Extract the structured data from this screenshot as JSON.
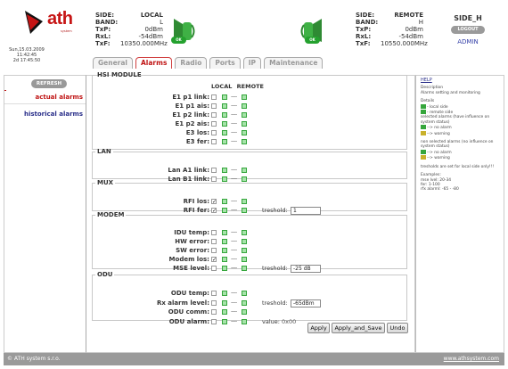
{
  "header": {
    "logo": {
      "text": "ath",
      "subtext": "system"
    },
    "clock": {
      "date": "Sun,15.03.2009",
      "time": "11:42:45",
      "uptime": "2d 17:45:50"
    },
    "local": {
      "side_label": "SIDE:",
      "side_value": "LOCAL",
      "band_label": "BAND:",
      "band_value": "L",
      "txp_label": "TxP:",
      "txp_value": "0dBm",
      "rxl_label": "RxL:",
      "rxl_value": "-54dBm",
      "txf_label": "TxF:",
      "txf_value": "10350.000MHz",
      "status": "OK"
    },
    "remote": {
      "side_label": "SIDE:",
      "side_value": "REMOTE",
      "band_label": "BAND:",
      "band_value": "H",
      "txp_label": "TxP:",
      "txp_value": "0dBm",
      "rxl_label": "RxL:",
      "rxl_value": "-54dBm",
      "txf_label": "TxF:",
      "txf_value": "10550.000MHz",
      "status": "OK"
    },
    "unit_name": "SIDE_H",
    "logout_label": "LOGOUT",
    "user": "ADMIN"
  },
  "tabs": [
    {
      "label": "General",
      "active": false
    },
    {
      "label": "Alarms",
      "active": true
    },
    {
      "label": "Radio",
      "active": false
    },
    {
      "label": "Ports",
      "active": false
    },
    {
      "label": "IP",
      "active": false
    },
    {
      "label": "Maintenance",
      "active": false
    }
  ],
  "nav": {
    "refresh_label": "REFRESH",
    "items": [
      {
        "label": "actual alarms",
        "active": true
      },
      {
        "label": "historical alarms",
        "active": false
      }
    ]
  },
  "alarms": {
    "col_local": "LOCAL",
    "col_remote": "REMOTE",
    "separator": "----",
    "sections": [
      {
        "title": "HSI MODULE",
        "rows": [
          {
            "label": "E1 p1 link:",
            "checked": false
          },
          {
            "label": "E1 p1 ais:",
            "checked": false
          },
          {
            "label": "E1 p2 link:",
            "checked": false
          },
          {
            "label": "E1 p2 ais:",
            "checked": false
          },
          {
            "label": "E3 los:",
            "checked": false
          },
          {
            "label": "E3 fer:",
            "checked": false
          }
        ]
      },
      {
        "title": "LAN",
        "rows": [
          {
            "label": "Lan A1 link:",
            "checked": false
          },
          {
            "label": "Lan B1 link:",
            "checked": false
          }
        ]
      },
      {
        "title": "MUX",
        "rows": [
          {
            "label": "RFI los:",
            "checked": true
          },
          {
            "label": "RFI fer:",
            "checked": true,
            "treshold_label": "treshold:",
            "treshold_value": "1"
          }
        ]
      },
      {
        "title": "MODEM",
        "rows": [
          {
            "label": "IDU temp:",
            "checked": false
          },
          {
            "label": "HW error:",
            "checked": false
          },
          {
            "label": "SW error:",
            "checked": false
          },
          {
            "label": "Modem los:",
            "checked": true
          },
          {
            "label": "MSE level:",
            "checked": false,
            "treshold_label": "treshold:",
            "treshold_value": "-25 dB"
          }
        ]
      },
      {
        "title": "ODU",
        "rows": [
          {
            "label": "ODU temp:",
            "checked": false
          },
          {
            "label": "Rx alarm level:",
            "checked": false,
            "treshold_label": "treshold:",
            "treshold_value": "-65dBm"
          },
          {
            "label": "ODU comm:",
            "checked": false
          },
          {
            "label": "ODU alarm:",
            "checked": false,
            "value_label": "value:",
            "value": "0x00"
          }
        ]
      }
    ]
  },
  "buttons": {
    "apply": "Apply",
    "apply_save": "Apply_and_Save",
    "undo": "Undo"
  },
  "help": {
    "title": "HELP",
    "description_label": "Description",
    "description": "Alarms setting and monitoring",
    "details_label": "Details",
    "local_side": "- local side",
    "remote_side": "- remote side",
    "selected_note": "selected alarms (have influence on system status)",
    "no_alarm": "--> no alarm",
    "warning": "--> warning",
    "nonselected_note": "non selected alarms (no influence on system status)",
    "treshold_note": "tresholds are set for local side only!!!",
    "examples_label": "Examples:",
    "ex1": "mse lvel: 20-34",
    "ex2": "fer: 1-100",
    "ex3": "rfx alarml: -65 - -80"
  },
  "footer": {
    "left": "© ATH system s.r.o.",
    "right": "www.athsystem.com"
  },
  "colors": {
    "accent": "#c01515",
    "ok": "#24a12e",
    "link": "#2a2f8a"
  }
}
